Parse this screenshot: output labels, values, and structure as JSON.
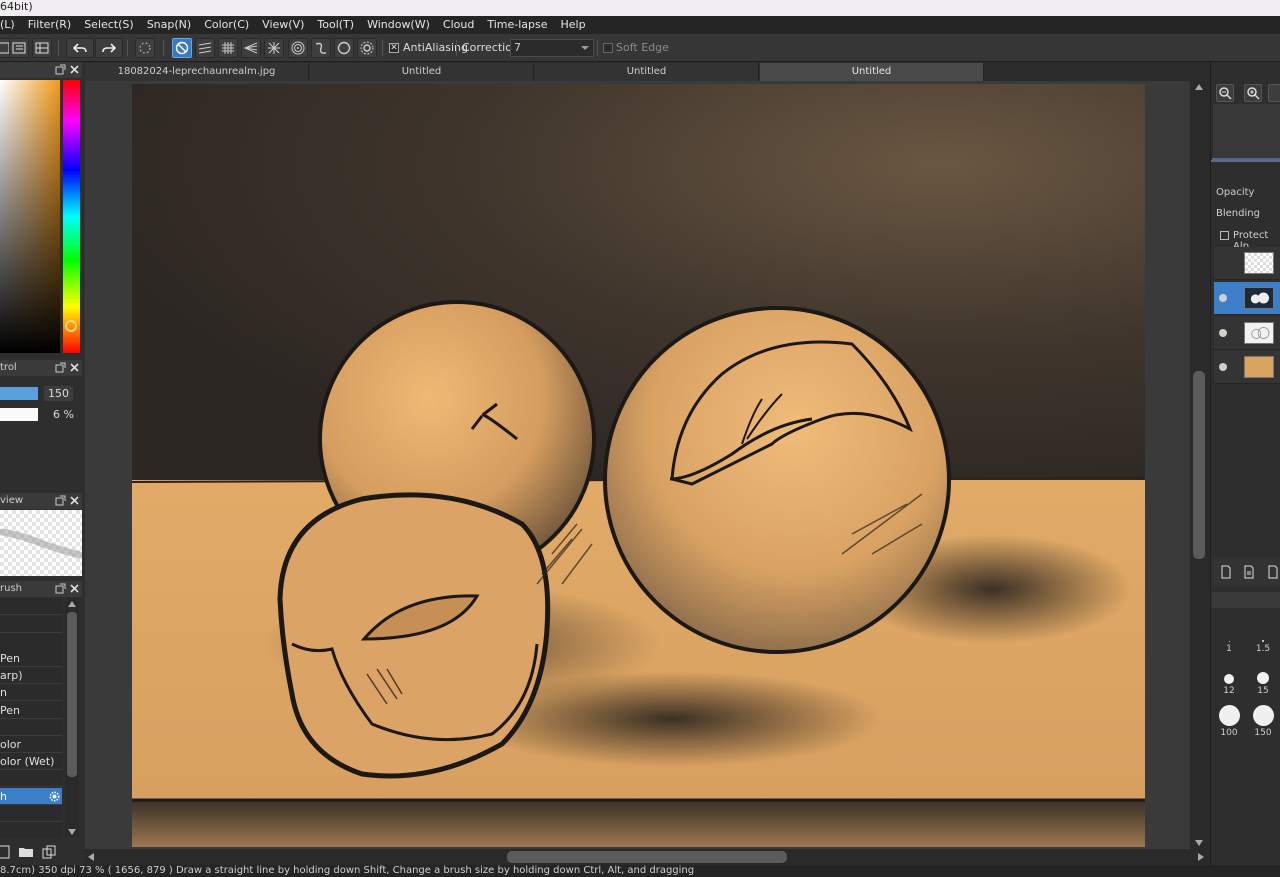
{
  "window": {
    "title": "64bit)"
  },
  "menu": [
    "(L)",
    "Filter(R)",
    "Select(S)",
    "Snap(N)",
    "Color(C)",
    "View(V)",
    "Tool(T)",
    "Window(W)",
    "Cloud",
    "Time-lapse",
    "Help"
  ],
  "toolbar": {
    "antialiasing_label": "AntiAliasing",
    "antialiasing_checked": "✕",
    "correction_label": "Correction",
    "correction_value": "7",
    "softedge_label": "Soft Edge"
  },
  "panels": {
    "color_control_title": "trol",
    "size_value": "150",
    "opacity_value": "6 %",
    "preview_title": "view",
    "brush_title": "rush"
  },
  "brushes": [
    "",
    "",
    "Pen",
    "arp)",
    "n",
    "Pen",
    "",
    "olor",
    "olor (Wet)",
    "",
    "h",
    ""
  ],
  "tabs": [
    "18082024-leprechaunrealm.jpg",
    "Untitled",
    "Untitled",
    "Untitled"
  ],
  "layers": {
    "opacity_label": "Opacity",
    "blending_label": "Blending",
    "protect_alpha_label": "Protect Alp"
  },
  "brush_sizes": [
    "1",
    "1.5",
    "12",
    "15",
    "100",
    "150"
  ],
  "status": {
    "text": "8.7cm)  350 dpi  73 %   ( 1656, 879 )   Draw a straight line by holding down Shift, Change a brush size by holding down Ctrl, Alt, and dragging"
  },
  "colors": {
    "accent": "#3d7ec8",
    "canvas_bg": "#3a3a3a",
    "paper": "#e0a864"
  }
}
